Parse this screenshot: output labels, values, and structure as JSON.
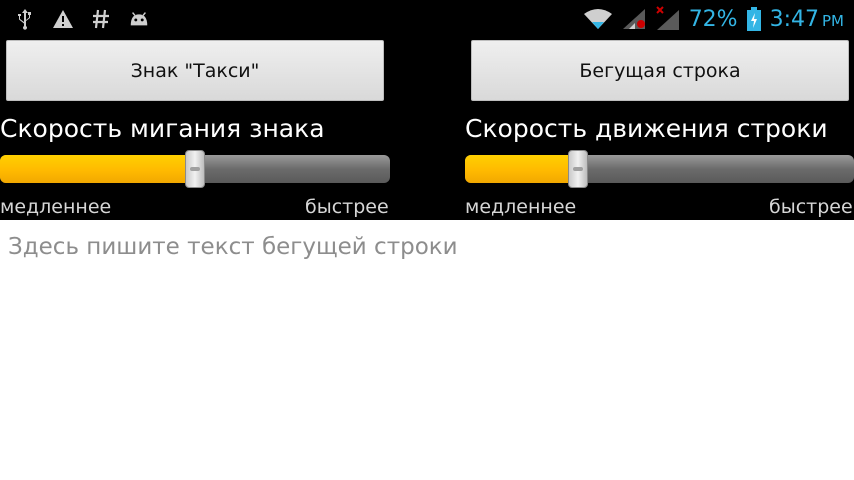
{
  "status_bar": {
    "left_icons": [
      "usb-icon",
      "warning-icon",
      "hash-icon",
      "android-icon"
    ],
    "right_icons": [
      "wifi-icon",
      "signal-icon",
      "signal-off-icon",
      "battery-icon"
    ],
    "battery_percent": "72%",
    "time": "3:47",
    "ampm": "PM",
    "accent_color": "#33b5e5"
  },
  "buttons": {
    "taxi_sign": "Знак \"Такси\"",
    "running_line": "Бегущая строка"
  },
  "sliders": {
    "blink": {
      "title": "Скорость мигания знака",
      "slow": "медленнее",
      "fast": "быстрее",
      "value": 0.5
    },
    "scroll": {
      "title": "Скорость движения строки",
      "slow": "медленнее",
      "fast": "быстрее",
      "value": 0.29
    },
    "fill_color": "#ffbf00"
  },
  "input": {
    "value": "",
    "placeholder": "Здесь пишите текст бегущей строки"
  }
}
